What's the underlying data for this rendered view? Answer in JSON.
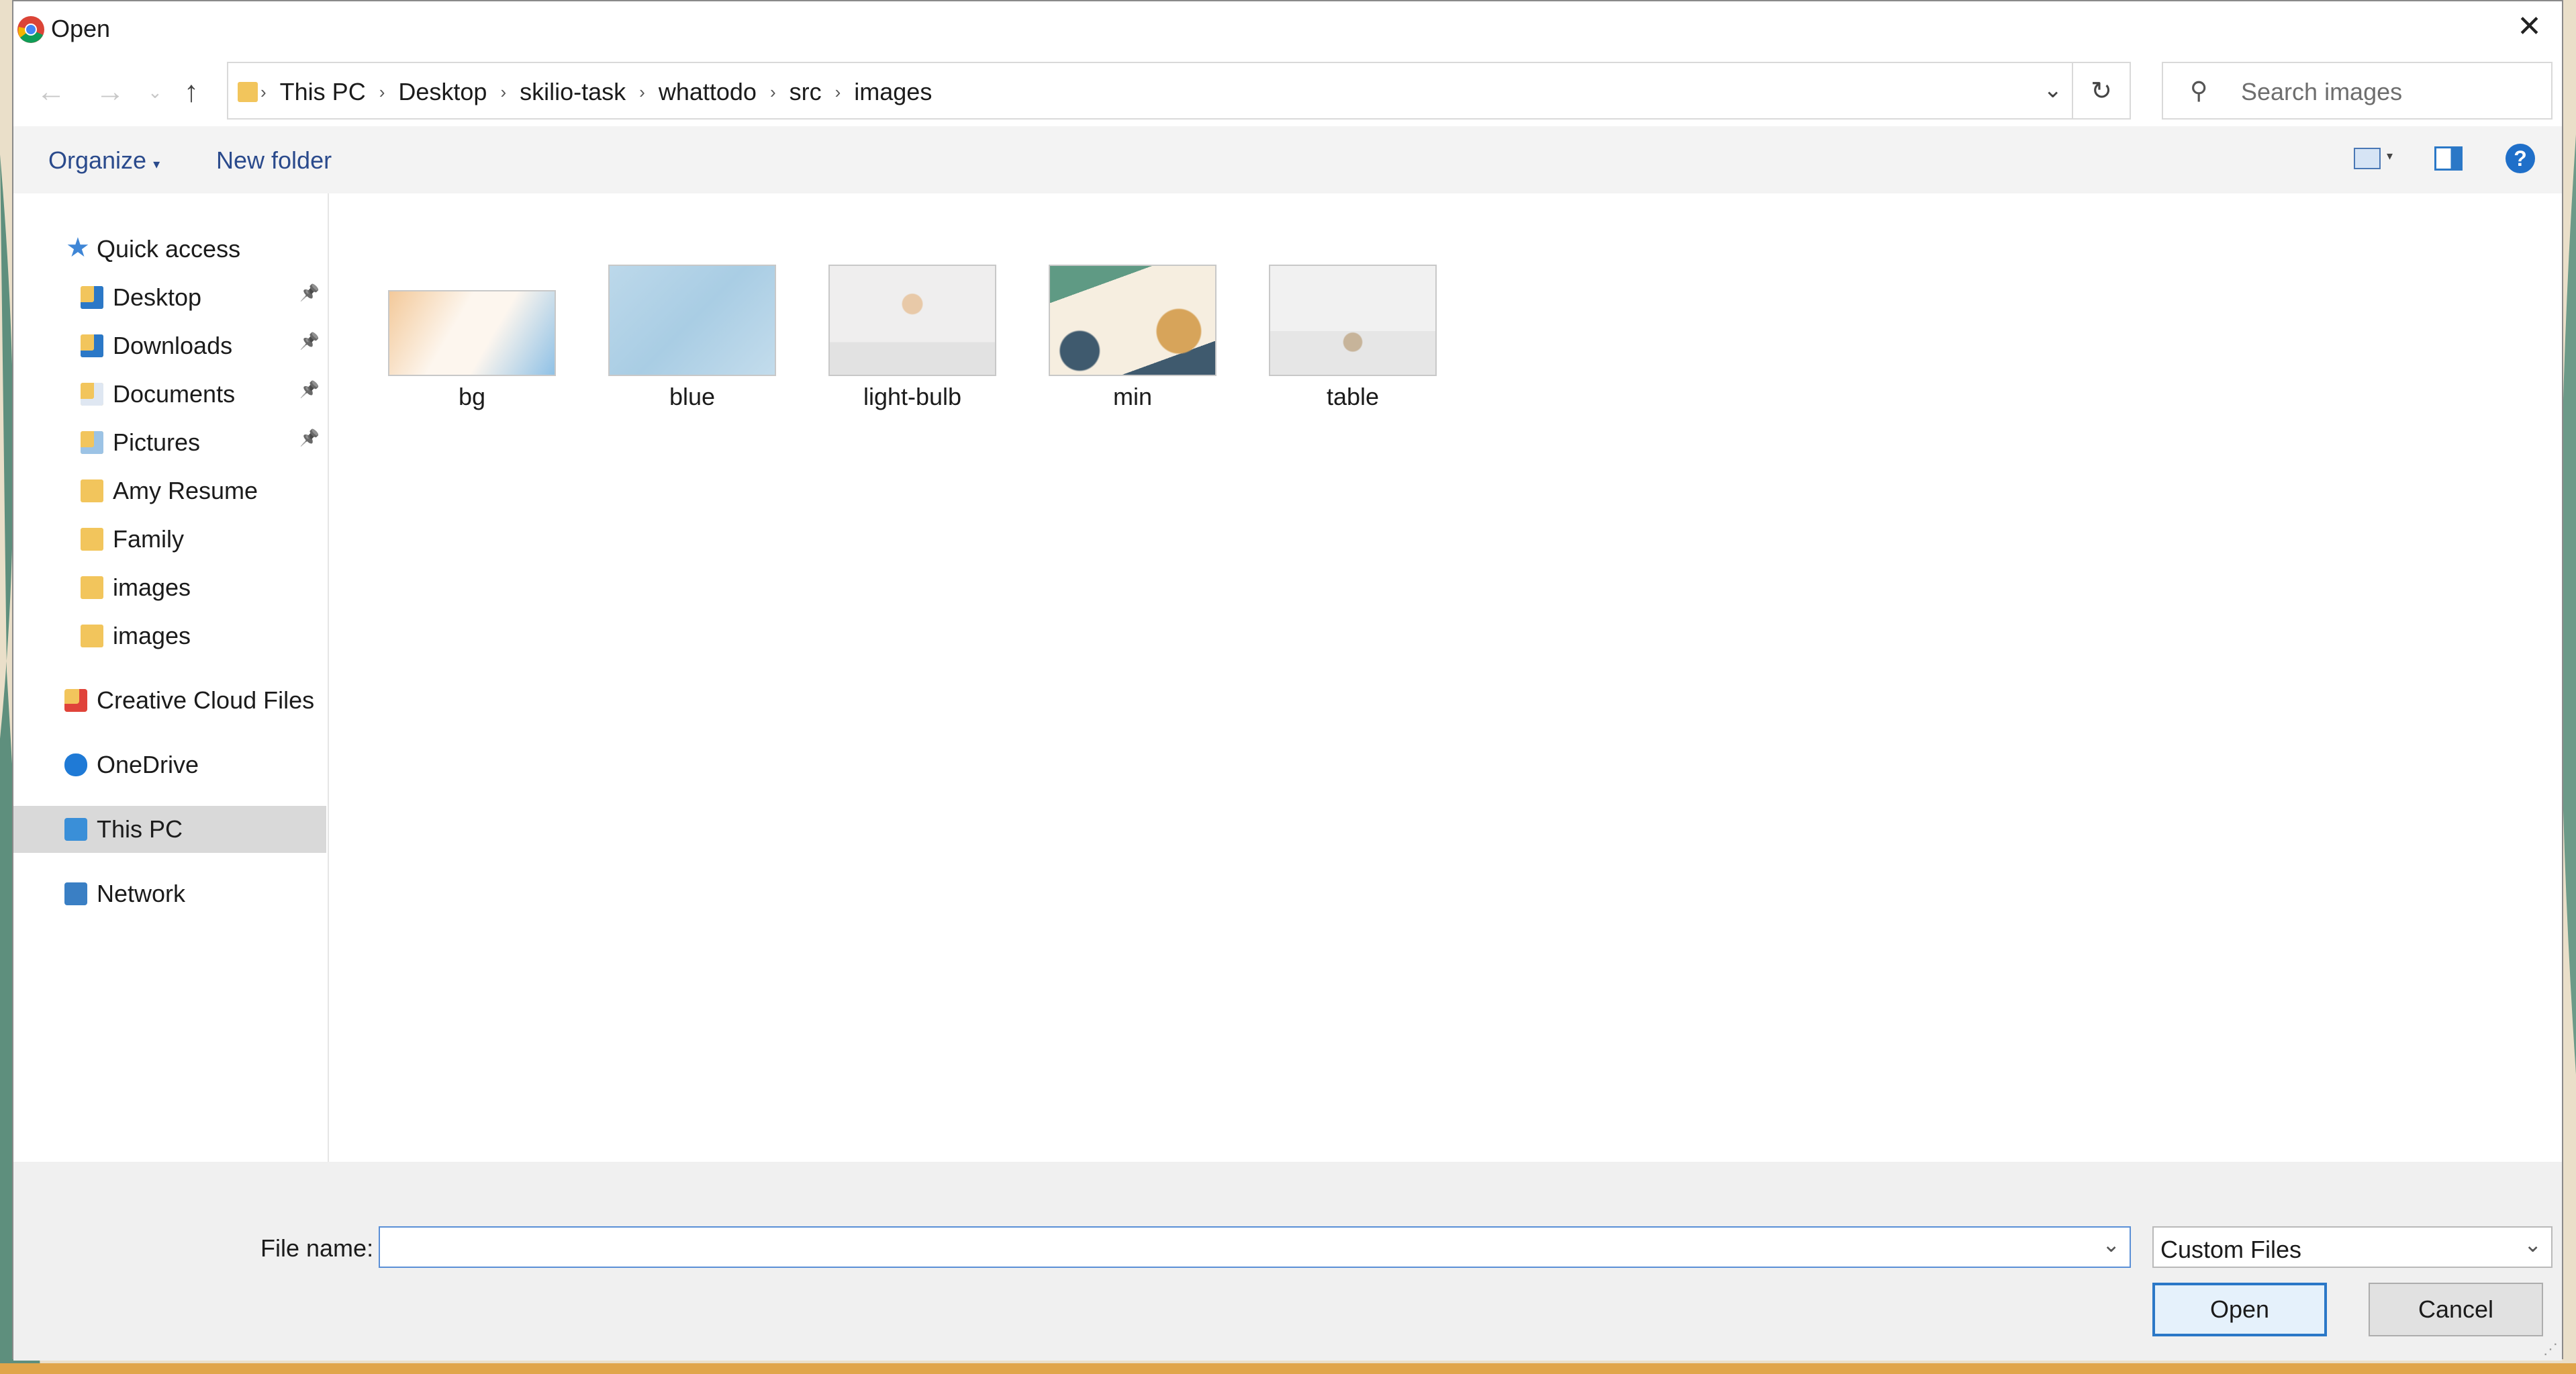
{
  "window": {
    "title": "Open"
  },
  "nav": {
    "back_icon": "arrow-left-icon",
    "forward_icon": "arrow-right-icon",
    "recent_icon": "chevron-down-icon",
    "up_icon": "arrow-up-icon",
    "breadcrumbs": [
      "This PC",
      "Desktop",
      "skilio-task",
      "whattodo",
      "src",
      "images"
    ],
    "refresh_icon": "refresh-icon"
  },
  "search": {
    "placeholder": "Search images"
  },
  "toolbar": {
    "organize": "Organize",
    "new_folder": "New folder"
  },
  "sidebar": {
    "quick_access": "Quick access",
    "quick_items": [
      {
        "label": "Desktop",
        "pinned": true
      },
      {
        "label": "Downloads",
        "pinned": true
      },
      {
        "label": "Documents",
        "pinned": true
      },
      {
        "label": "Pictures",
        "pinned": true
      },
      {
        "label": "Amy Resume",
        "pinned": false
      },
      {
        "label": "Family",
        "pinned": false
      },
      {
        "label": "images",
        "pinned": false
      },
      {
        "label": "images",
        "pinned": false
      }
    ],
    "creative_cloud": "Creative Cloud Files",
    "onedrive": "OneDrive",
    "this_pc": "This PC",
    "network": "Network"
  },
  "files": [
    {
      "name": "bg"
    },
    {
      "name": "blue"
    },
    {
      "name": "light-bulb"
    },
    {
      "name": "min"
    },
    {
      "name": "table"
    }
  ],
  "footer": {
    "file_name_label": "File name:",
    "file_name_value": "",
    "filter_value": "Custom Files",
    "open_label": "Open",
    "cancel_label": "Cancel"
  },
  "colors": {
    "accent": "#2b78c7",
    "selection": "#d9d9d9",
    "link": "#2a4a8c"
  }
}
